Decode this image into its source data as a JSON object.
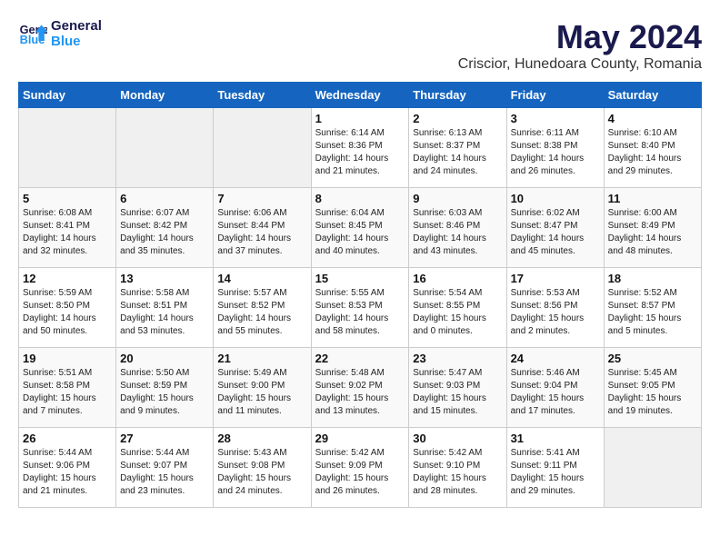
{
  "logo": {
    "text_general": "General",
    "text_blue": "Blue"
  },
  "title": "May 2024",
  "subtitle": "Criscior, Hunedoara County, Romania",
  "days_of_week": [
    "Sunday",
    "Monday",
    "Tuesday",
    "Wednesday",
    "Thursday",
    "Friday",
    "Saturday"
  ],
  "weeks": [
    [
      {
        "day": "",
        "info": ""
      },
      {
        "day": "",
        "info": ""
      },
      {
        "day": "",
        "info": ""
      },
      {
        "day": "1",
        "info": "Sunrise: 6:14 AM\nSunset: 8:36 PM\nDaylight: 14 hours and 21 minutes."
      },
      {
        "day": "2",
        "info": "Sunrise: 6:13 AM\nSunset: 8:37 PM\nDaylight: 14 hours and 24 minutes."
      },
      {
        "day": "3",
        "info": "Sunrise: 6:11 AM\nSunset: 8:38 PM\nDaylight: 14 hours and 26 minutes."
      },
      {
        "day": "4",
        "info": "Sunrise: 6:10 AM\nSunset: 8:40 PM\nDaylight: 14 hours and 29 minutes."
      }
    ],
    [
      {
        "day": "5",
        "info": "Sunrise: 6:08 AM\nSunset: 8:41 PM\nDaylight: 14 hours and 32 minutes."
      },
      {
        "day": "6",
        "info": "Sunrise: 6:07 AM\nSunset: 8:42 PM\nDaylight: 14 hours and 35 minutes."
      },
      {
        "day": "7",
        "info": "Sunrise: 6:06 AM\nSunset: 8:44 PM\nDaylight: 14 hours and 37 minutes."
      },
      {
        "day": "8",
        "info": "Sunrise: 6:04 AM\nSunset: 8:45 PM\nDaylight: 14 hours and 40 minutes."
      },
      {
        "day": "9",
        "info": "Sunrise: 6:03 AM\nSunset: 8:46 PM\nDaylight: 14 hours and 43 minutes."
      },
      {
        "day": "10",
        "info": "Sunrise: 6:02 AM\nSunset: 8:47 PM\nDaylight: 14 hours and 45 minutes."
      },
      {
        "day": "11",
        "info": "Sunrise: 6:00 AM\nSunset: 8:49 PM\nDaylight: 14 hours and 48 minutes."
      }
    ],
    [
      {
        "day": "12",
        "info": "Sunrise: 5:59 AM\nSunset: 8:50 PM\nDaylight: 14 hours and 50 minutes."
      },
      {
        "day": "13",
        "info": "Sunrise: 5:58 AM\nSunset: 8:51 PM\nDaylight: 14 hours and 53 minutes."
      },
      {
        "day": "14",
        "info": "Sunrise: 5:57 AM\nSunset: 8:52 PM\nDaylight: 14 hours and 55 minutes."
      },
      {
        "day": "15",
        "info": "Sunrise: 5:55 AM\nSunset: 8:53 PM\nDaylight: 14 hours and 58 minutes."
      },
      {
        "day": "16",
        "info": "Sunrise: 5:54 AM\nSunset: 8:55 PM\nDaylight: 15 hours and 0 minutes."
      },
      {
        "day": "17",
        "info": "Sunrise: 5:53 AM\nSunset: 8:56 PM\nDaylight: 15 hours and 2 minutes."
      },
      {
        "day": "18",
        "info": "Sunrise: 5:52 AM\nSunset: 8:57 PM\nDaylight: 15 hours and 5 minutes."
      }
    ],
    [
      {
        "day": "19",
        "info": "Sunrise: 5:51 AM\nSunset: 8:58 PM\nDaylight: 15 hours and 7 minutes."
      },
      {
        "day": "20",
        "info": "Sunrise: 5:50 AM\nSunset: 8:59 PM\nDaylight: 15 hours and 9 minutes."
      },
      {
        "day": "21",
        "info": "Sunrise: 5:49 AM\nSunset: 9:00 PM\nDaylight: 15 hours and 11 minutes."
      },
      {
        "day": "22",
        "info": "Sunrise: 5:48 AM\nSunset: 9:02 PM\nDaylight: 15 hours and 13 minutes."
      },
      {
        "day": "23",
        "info": "Sunrise: 5:47 AM\nSunset: 9:03 PM\nDaylight: 15 hours and 15 minutes."
      },
      {
        "day": "24",
        "info": "Sunrise: 5:46 AM\nSunset: 9:04 PM\nDaylight: 15 hours and 17 minutes."
      },
      {
        "day": "25",
        "info": "Sunrise: 5:45 AM\nSunset: 9:05 PM\nDaylight: 15 hours and 19 minutes."
      }
    ],
    [
      {
        "day": "26",
        "info": "Sunrise: 5:44 AM\nSunset: 9:06 PM\nDaylight: 15 hours and 21 minutes."
      },
      {
        "day": "27",
        "info": "Sunrise: 5:44 AM\nSunset: 9:07 PM\nDaylight: 15 hours and 23 minutes."
      },
      {
        "day": "28",
        "info": "Sunrise: 5:43 AM\nSunset: 9:08 PM\nDaylight: 15 hours and 24 minutes."
      },
      {
        "day": "29",
        "info": "Sunrise: 5:42 AM\nSunset: 9:09 PM\nDaylight: 15 hours and 26 minutes."
      },
      {
        "day": "30",
        "info": "Sunrise: 5:42 AM\nSunset: 9:10 PM\nDaylight: 15 hours and 28 minutes."
      },
      {
        "day": "31",
        "info": "Sunrise: 5:41 AM\nSunset: 9:11 PM\nDaylight: 15 hours and 29 minutes."
      },
      {
        "day": "",
        "info": ""
      }
    ]
  ]
}
